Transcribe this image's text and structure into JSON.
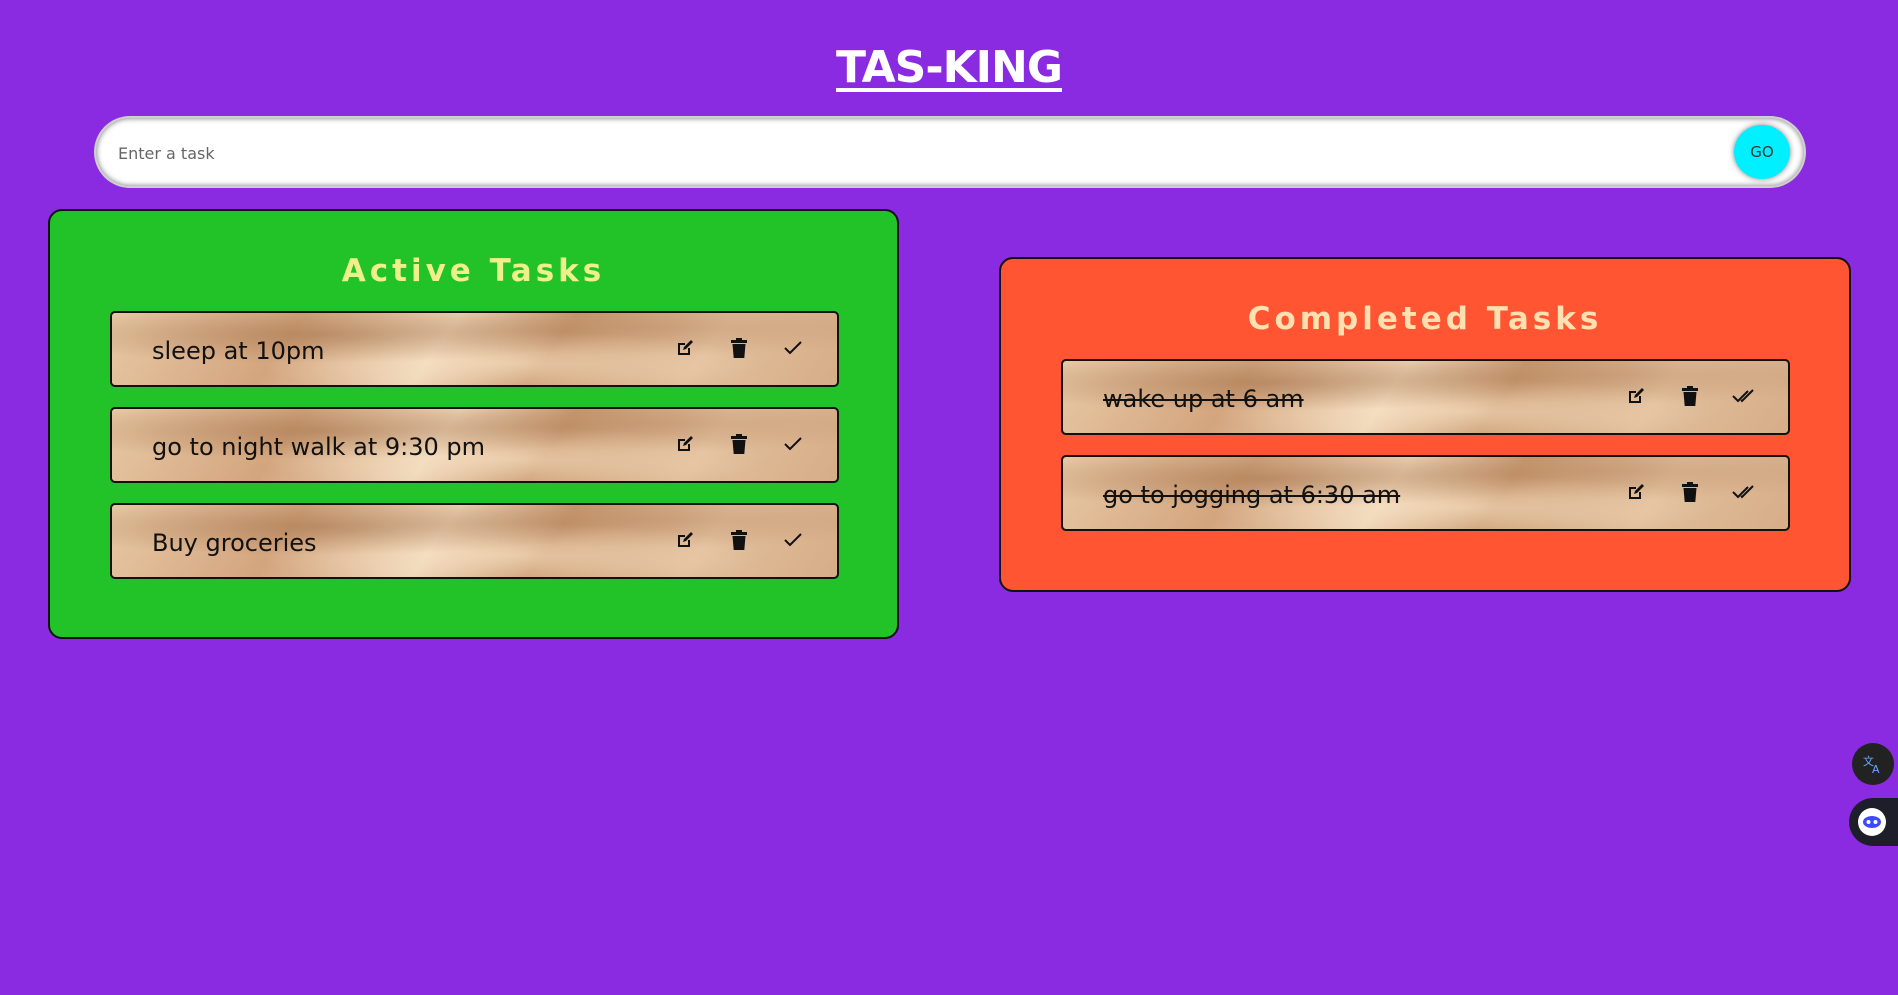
{
  "app": {
    "title": "TAS-KING"
  },
  "task_input": {
    "placeholder": "Enter a task",
    "go_label": "GO"
  },
  "active_panel": {
    "title": "Active Tasks",
    "tasks": [
      {
        "text": "sleep at 10pm"
      },
      {
        "text": "go to night walk at 9:30 pm"
      },
      {
        "text": "Buy groceries"
      }
    ]
  },
  "completed_panel": {
    "title": "Completed Tasks",
    "tasks": [
      {
        "text": "wake up at 6 am"
      },
      {
        "text": "go to jogging at 6:30 am"
      }
    ]
  },
  "colors": {
    "background": "#8a2be2",
    "active_panel": "#22c229",
    "completed_panel": "#ff5533",
    "go_button": "#00f0ff"
  },
  "icons": {
    "edit": "edit-icon",
    "delete": "trash-icon",
    "complete": "check-icon",
    "completed": "double-check-icon",
    "translate": "translate-icon",
    "assistant": "assistant-icon"
  }
}
